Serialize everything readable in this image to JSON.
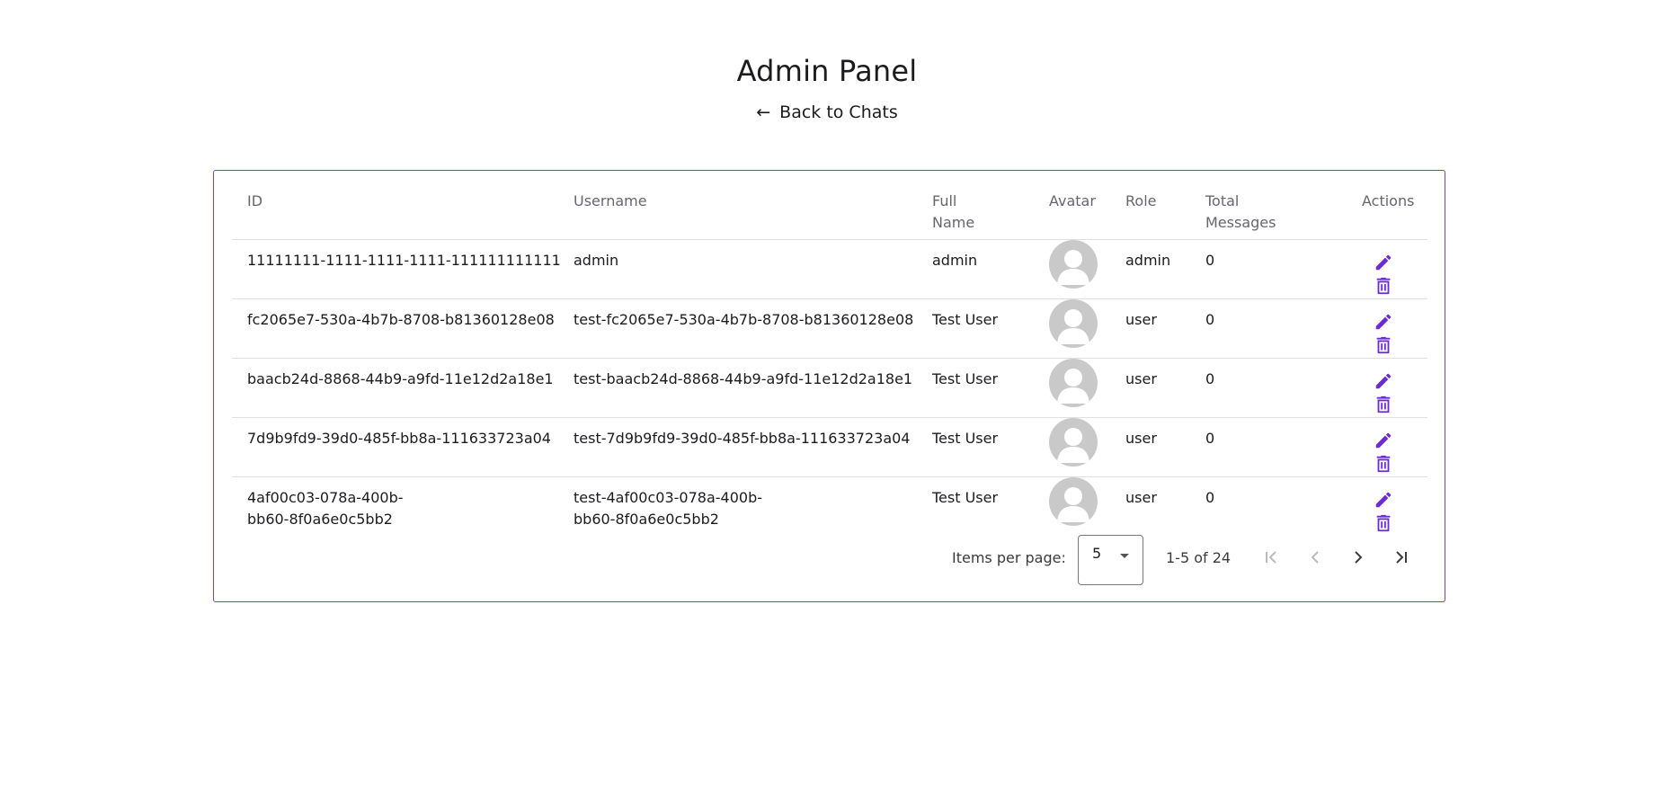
{
  "page": {
    "title": "Admin Panel",
    "back_arrow": "←",
    "back_label": "Back to Chats"
  },
  "table": {
    "headers": {
      "id": "ID",
      "username": "Username",
      "full_name_1": "Full",
      "full_name_2": "Name",
      "avatar": "Avatar",
      "role": "Role",
      "total_messages_1": "Total",
      "total_messages_2": "Messages",
      "actions": "Actions"
    },
    "rows": [
      {
        "id": "11111111-1111-1111-1111-111111111111",
        "username": "admin",
        "full_name": "admin",
        "role": "admin",
        "total_messages": "0"
      },
      {
        "id": "fc2065e7-530a-4b7b-8708-b81360128e08",
        "username": "test-fc2065e7-530a-4b7b-8708-b81360128e08",
        "full_name": "Test User",
        "role": "user",
        "total_messages": "0"
      },
      {
        "id": "baacb24d-8868-44b9-a9fd-11e12d2a18e1",
        "username": "test-baacb24d-8868-44b9-a9fd-11e12d2a18e1",
        "full_name": "Test User",
        "role": "user",
        "total_messages": "0"
      },
      {
        "id": "7d9b9fd9-39d0-485f-bb8a-111633723a04",
        "username": "test-7d9b9fd9-39d0-485f-bb8a-111633723a04",
        "full_name": "Test User",
        "role": "user",
        "total_messages": "0"
      },
      {
        "id_line1": "4af00c03-078a-400b-",
        "id_line2": "bb60-8f0a6e0c5bb2",
        "username_line1": "test-4af00c03-078a-400b-",
        "username_line2": "bb60-8f0a6e0c5bb2",
        "full_name": "Test User",
        "role": "user",
        "total_messages": "0"
      }
    ]
  },
  "paginator": {
    "items_per_page_label": "Items per page:",
    "page_size": "5",
    "range_label": "1-5 of 24"
  },
  "colors": {
    "accent": "#7b3fd0",
    "icon_purple": "#6c2bd9",
    "avatar_bg": "#c9c9c9"
  }
}
